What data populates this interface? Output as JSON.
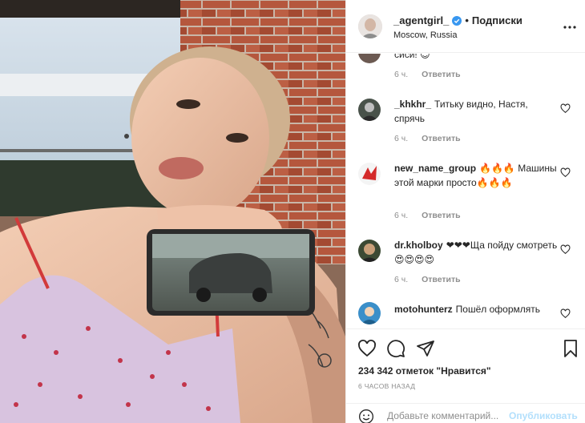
{
  "post": {
    "username": "_agentgirl_",
    "separator": "•",
    "follow_label": "Подписки",
    "location": "Moscow, Russia",
    "verified": true
  },
  "comments": [
    {
      "username": "",
      "text": "сиси! 😊",
      "time": "6 ч.",
      "reply_label": "Ответить"
    },
    {
      "username": "_khkhr_",
      "text": "Титьку видно, Настя, спрячь",
      "time": "6 ч.",
      "reply_label": "Ответить"
    },
    {
      "username": "new_name_group",
      "text": "🔥🔥🔥 Машины этой марки просто🔥🔥🔥",
      "time": "6 ч.",
      "reply_label": "Ответить"
    },
    {
      "username": "dr.kholboy",
      "text": "❤❤❤Ща пойду смотреть 😍😍😍😍",
      "time": "6 ч.",
      "reply_label": "Ответить"
    },
    {
      "username": "motohunterz",
      "text": "Пошёл оформлять",
      "time": "",
      "reply_label": ""
    }
  ],
  "actions": {
    "likes_text": "234 342 отметок \"Нравится\"",
    "posted_time": "6 часов назад"
  },
  "add_comment": {
    "placeholder": "Добавьте комментарий...",
    "publish_label": "Опубликовать"
  },
  "colors": {
    "accent": "#0095f6",
    "publish_disabled": "#b2dffc",
    "muted": "#8e8e8e",
    "text": "#262626",
    "border": "#efefef"
  }
}
